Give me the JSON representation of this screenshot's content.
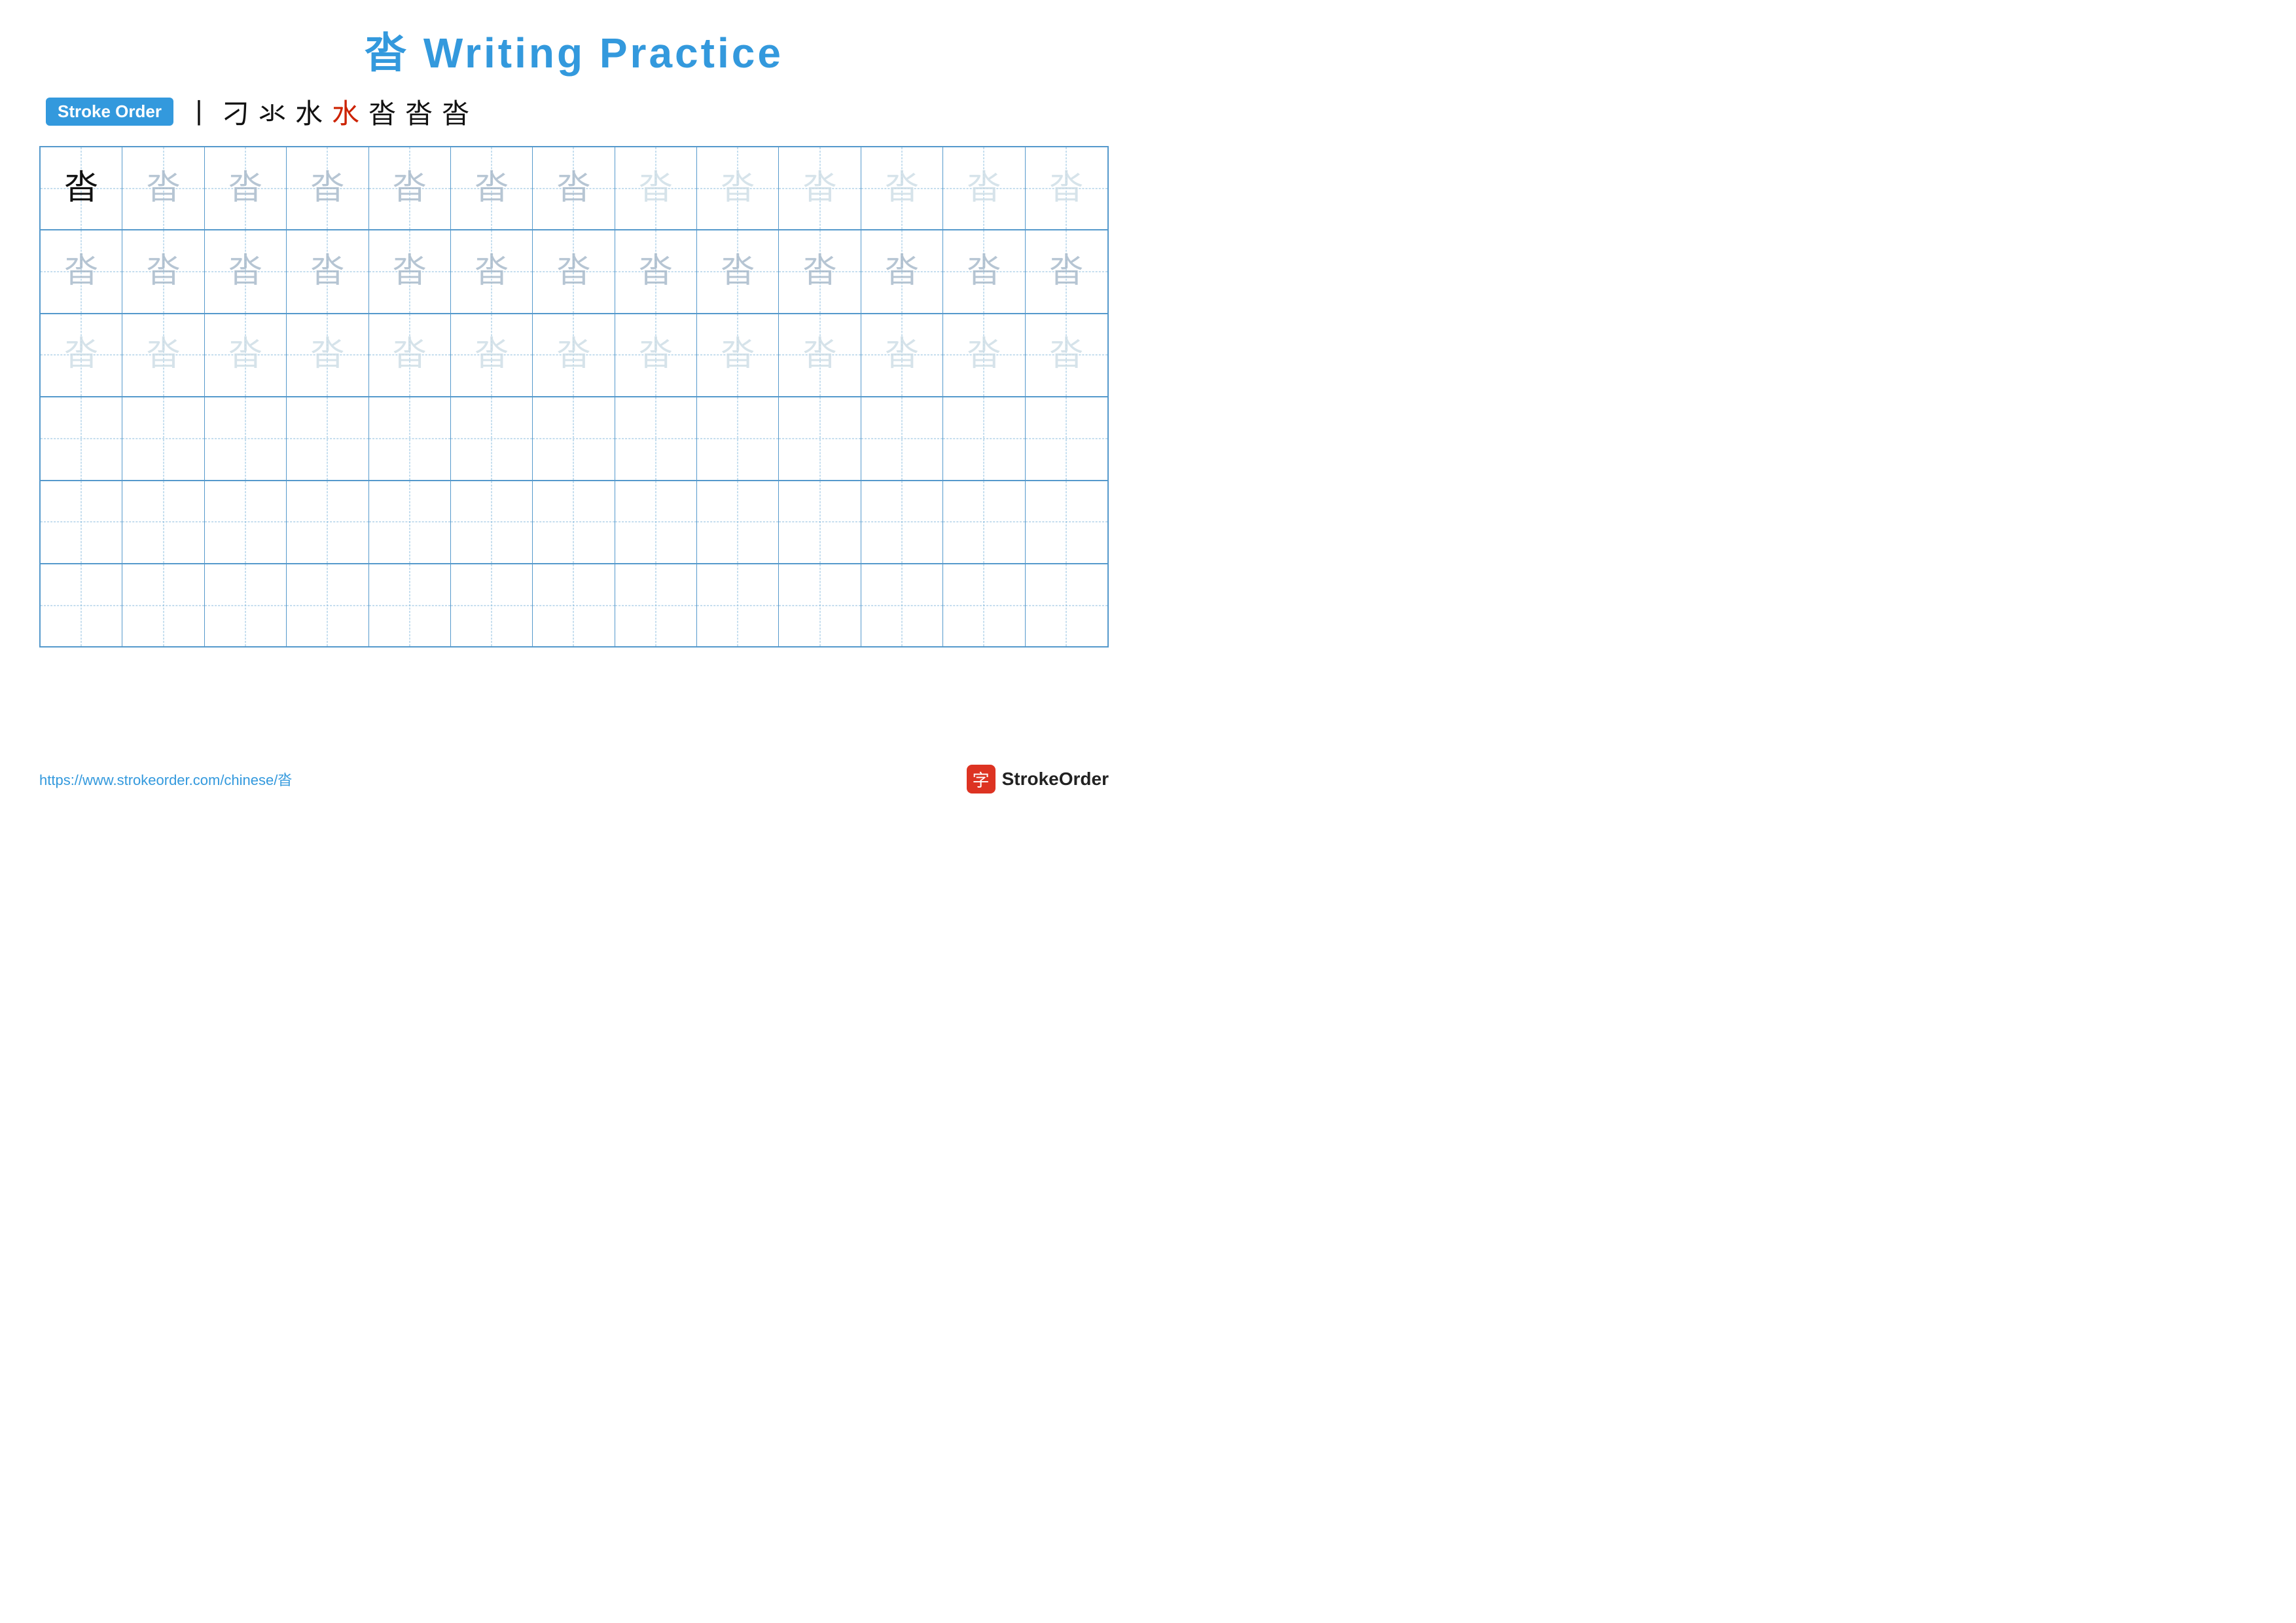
{
  "title": {
    "char": "沓",
    "text": " Writing Practice"
  },
  "stroke_order": {
    "badge_label": "Stroke Order",
    "strokes": [
      {
        "char": "丨",
        "color": "black"
      },
      {
        "char": "刁",
        "color": "black"
      },
      {
        "char": "氺",
        "color": "black"
      },
      {
        "char": "水",
        "color": "black"
      },
      {
        "char": "水",
        "color": "red"
      },
      {
        "char": "沓",
        "color": "black"
      },
      {
        "char": "沓",
        "color": "black"
      },
      {
        "char": "沓",
        "color": "black"
      }
    ]
  },
  "grid": {
    "rows": 6,
    "cols": 13,
    "char": "沓",
    "row_configs": [
      {
        "shade": "dark"
      },
      {
        "shade": "medium"
      },
      {
        "shade": "light"
      },
      {
        "shade": "empty"
      },
      {
        "shade": "empty"
      },
      {
        "shade": "empty"
      }
    ]
  },
  "footer": {
    "url": "https://www.strokeorder.com/chinese/沓",
    "logo_char": "字",
    "logo_text": "StrokeOrder"
  }
}
